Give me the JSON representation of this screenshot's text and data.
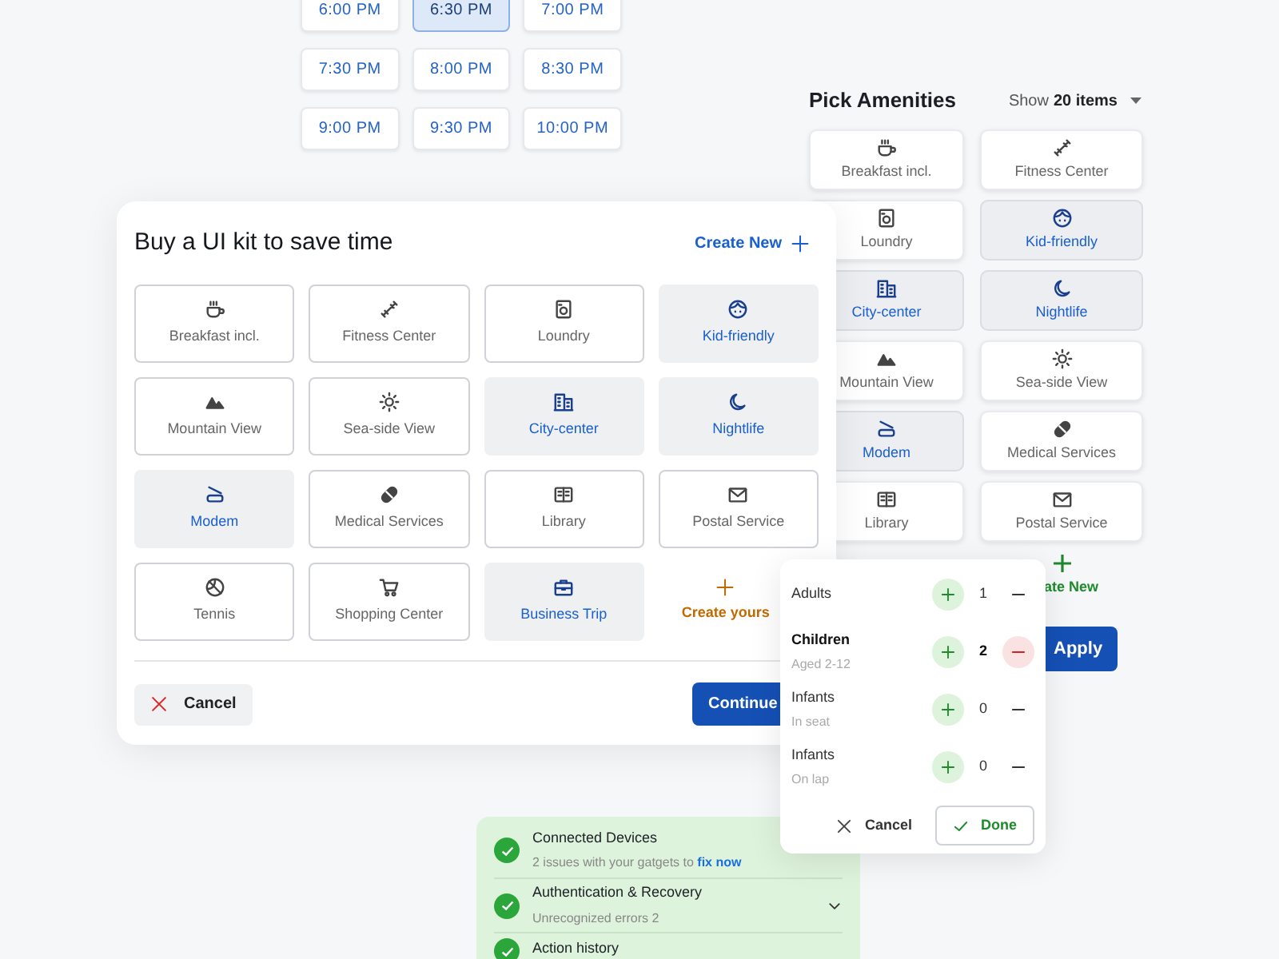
{
  "time_slots": [
    {
      "label": "6:00 PM",
      "selected": false
    },
    {
      "label": "6:30 PM",
      "selected": true
    },
    {
      "label": "7:00 PM",
      "selected": false
    },
    {
      "label": "7:30 PM",
      "selected": false
    },
    {
      "label": "8:00 PM",
      "selected": false
    },
    {
      "label": "8:30 PM",
      "selected": false
    },
    {
      "label": "9:00 PM",
      "selected": false
    },
    {
      "label": "9:30 PM",
      "selected": false
    },
    {
      "label": "10:00 PM",
      "selected": false
    }
  ],
  "amenities_panel": {
    "title": "Pick Amenities",
    "show_label": "Show",
    "show_count": "20 items",
    "items": [
      {
        "label": "Breakfast incl.",
        "selected": false
      },
      {
        "label": "Fitness Center",
        "selected": false
      },
      {
        "label": "Loundry",
        "selected": false
      },
      {
        "label": "Kid-friendly",
        "selected": true
      },
      {
        "label": "City-center",
        "selected": true
      },
      {
        "label": "Nightlife",
        "selected": true
      },
      {
        "label": "Mountain View",
        "selected": false
      },
      {
        "label": "Sea-side View",
        "selected": false
      },
      {
        "label": "Modem",
        "selected": true
      },
      {
        "label": "Medical Services",
        "selected": false
      },
      {
        "label": "Library",
        "selected": false
      },
      {
        "label": "Postal Service",
        "selected": false
      }
    ],
    "create_label": "ate New",
    "apply_button": "Apply"
  },
  "kit_dialog": {
    "title": "Buy a UI kit to save time",
    "create_new": "Create New",
    "items": [
      {
        "label": "Breakfast incl.",
        "selected": false,
        "kind": "option"
      },
      {
        "label": "Fitness Center",
        "selected": false,
        "kind": "option"
      },
      {
        "label": "Loundry",
        "selected": false,
        "kind": "option"
      },
      {
        "label": "Kid-friendly",
        "selected": true,
        "kind": "option"
      },
      {
        "label": "Mountain View",
        "selected": false,
        "kind": "option"
      },
      {
        "label": "Sea-side View",
        "selected": false,
        "kind": "option"
      },
      {
        "label": "City-center",
        "selected": true,
        "kind": "option"
      },
      {
        "label": "Nightlife",
        "selected": true,
        "kind": "option"
      },
      {
        "label": "Modem",
        "selected": true,
        "kind": "option"
      },
      {
        "label": "Medical Services",
        "selected": false,
        "kind": "option"
      },
      {
        "label": "Library",
        "selected": false,
        "kind": "option"
      },
      {
        "label": "Postal Service",
        "selected": false,
        "kind": "option"
      },
      {
        "label": "Tennis",
        "selected": false,
        "kind": "option"
      },
      {
        "label": "Shopping Center",
        "selected": false,
        "kind": "option"
      },
      {
        "label": "Business Trip",
        "selected": true,
        "kind": "option"
      },
      {
        "label": "Create yours",
        "kind": "create"
      }
    ],
    "cancel_button": "Cancel",
    "continue_button": "Continue"
  },
  "guests_popup": {
    "rows": [
      {
        "label": "Adults",
        "count": "1",
        "minus_enabled": false
      },
      {
        "label": "Children",
        "sub": "Aged 2-12",
        "count": "2",
        "minus_enabled": true
      },
      {
        "label": "Infants",
        "sub": "In seat",
        "count": "0",
        "minus_enabled": false
      },
      {
        "label": "Infants",
        "sub": "On lap",
        "count": "0",
        "minus_enabled": false
      }
    ],
    "cancel_button": "Cancel",
    "done_button": "Done"
  },
  "security_panel": {
    "items": [
      {
        "title": "Connected Devices",
        "subtitle": "2 issues with your gatgets to",
        "link": "fix now",
        "checked": true,
        "expandable": false
      },
      {
        "title": "Authentication & Recovery",
        "subtitle": "Unrecognized errors 2",
        "checked": true,
        "expandable": true
      },
      {
        "title": "Action history",
        "checked": true,
        "expandable": false
      }
    ]
  }
}
